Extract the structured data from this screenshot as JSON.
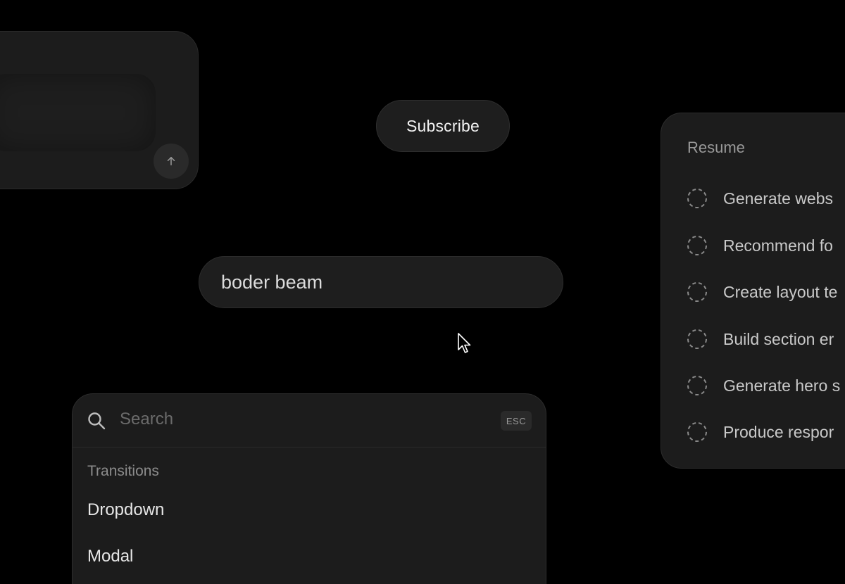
{
  "subscribe": {
    "label": "Subscribe"
  },
  "beam_input": {
    "value": "boder beam"
  },
  "command_menu": {
    "search_placeholder": "Search",
    "esc_label": "ESC",
    "group_label": "Transitions",
    "items": [
      "Dropdown",
      "Modal"
    ]
  },
  "task_card": {
    "title": "Resume",
    "tasks": [
      "Generate webs",
      "Recommend fo",
      "Create layout te",
      "Build section er",
      "Generate hero s",
      "Produce respor"
    ]
  },
  "icons": {
    "send": "arrow-up-icon",
    "search": "search-icon",
    "task_status": "dashed-circle-icon",
    "cursor": "mouse-pointer-icon"
  },
  "colors": {
    "background": "#000000",
    "surface": "#1c1c1c",
    "text_primary": "#e6e6e6",
    "text_muted": "#8c8c8c"
  }
}
